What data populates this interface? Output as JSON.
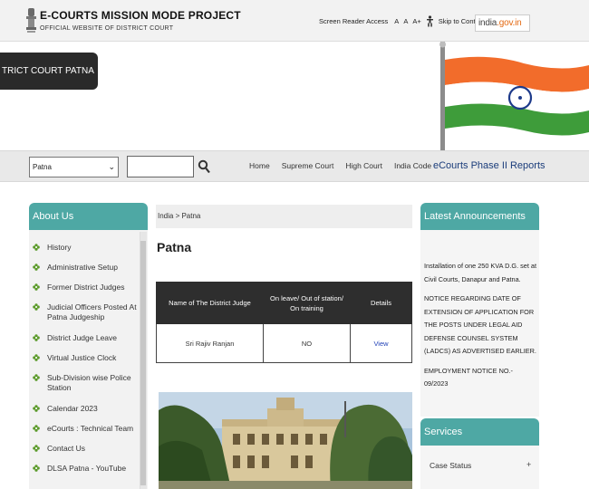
{
  "header": {
    "title": "E-COURTS MISSION MODE PROJECT",
    "subtitle": "OFFICIAL WEBSITE OF DISTRICT COURT",
    "screen_reader": "Screen Reader Access",
    "font_small": "A",
    "font_normal": "A",
    "font_large": "A+",
    "skip": "Skip to Content",
    "india_logo_pre": "india",
    "india_logo_post": ".gov.in"
  },
  "banner": {
    "court_name": "TRICT COURT PATNA"
  },
  "nav": {
    "select_value": "Patna",
    "links": [
      "Home",
      "Supreme Court",
      "High Court",
      "India Code"
    ],
    "reports": "eCourts Phase II Reports"
  },
  "about": {
    "heading": "About Us",
    "items": [
      "History",
      "Administrative Setup",
      "Former District Judges",
      "Judicial Officers Posted At Patna Judgeship",
      "District Judge Leave",
      "Virtual Justice Clock",
      "Sub-Division wise Police Station",
      "Calendar 2023",
      "eCourts : Technical Team",
      "Contact Us",
      "DLSA Patna - YouTube"
    ]
  },
  "main": {
    "breadcrumb": "India > Patna",
    "title": "Patna",
    "table": {
      "headers": [
        "Name of The District Judge",
        "On leave/ Out of station/ On training",
        "Details"
      ],
      "row": [
        "Sri Rajiv Ranjan",
        "NO",
        "View"
      ]
    }
  },
  "announcements": {
    "heading": "Latest Announcements",
    "items": [
      "Installation of one 250 KVA D.G. set at Civil Courts, Danapur and Patna.",
      "NOTICE REGARDING DATE OF EXTENSION OF APPLICATION FOR THE POSTS UNDER LEGAL AID DEFENSE COUNSEL SYSTEM (LADCS) AS ADVERTISED EARLIER.",
      "EMPLOYMENT NOTICE NO.- 09/2023"
    ]
  },
  "services": {
    "heading": "Services",
    "item": "Case Status",
    "plus": "+"
  },
  "colors": {
    "teal": "#4ea8a4",
    "dark": "#2e2e2e",
    "saffron": "#f26c2b",
    "green": "#3e9c3a",
    "reports_blue": "#1a3c7a"
  }
}
